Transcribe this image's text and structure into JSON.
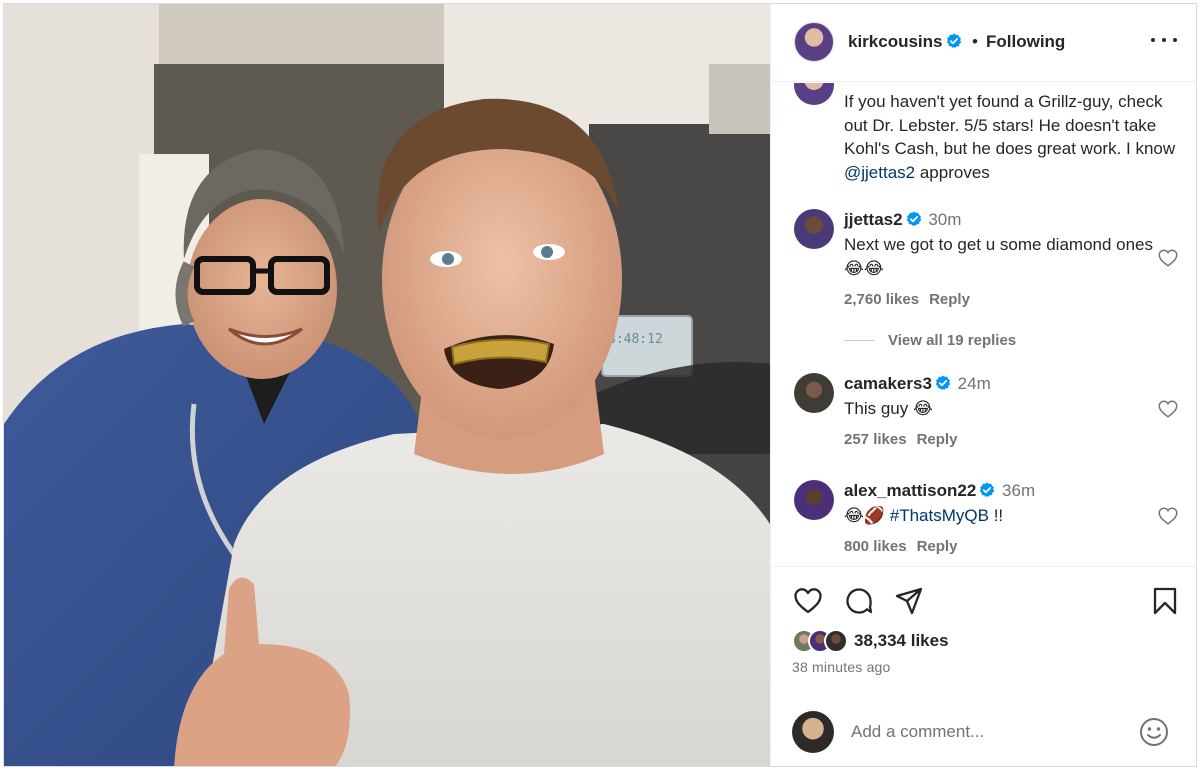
{
  "post": {
    "username": "kirkcousins",
    "follow_separator": "•",
    "follow_status": "Following",
    "caption": "If you haven't yet found a Grillz-guy, check out Dr. Lebster. 5/5 stars! He doesn't take Kohl's Cash, but he does great work. I know ",
    "caption_mention": "@jjettas2",
    "caption_end": " approves",
    "photo_clock": "3:48:12"
  },
  "comments": [
    {
      "username": "jjettas2",
      "time": "30m",
      "text": "Next we got to get u some diamond ones😂😂",
      "likes": "2,760 likes",
      "reply": "Reply"
    },
    {
      "username": "camakers3",
      "time": "24m",
      "text": "This guy 😂",
      "likes": "257 likes",
      "reply": "Reply"
    },
    {
      "username": "alex_mattison22",
      "time": "36m",
      "text_emoji": "😂🏈 ",
      "text_tag": "#ThatsMyQB",
      "text_end": " !!",
      "likes": "800 likes",
      "reply": "Reply"
    }
  ],
  "view_replies": "View all 19 replies",
  "footer": {
    "likes": "38,334 likes",
    "time_ago": "38 minutes ago",
    "comment_placeholder": "Add a comment..."
  },
  "icons": [
    "heart-icon",
    "comment-icon",
    "share-icon",
    "bookmark-icon",
    "emoji-icon",
    "more-icon",
    "verified-icon"
  ],
  "colors": {
    "link": "#00376b",
    "verified": "#0095f6",
    "secondary_text": "#737373",
    "border": "#dbdbdb"
  }
}
